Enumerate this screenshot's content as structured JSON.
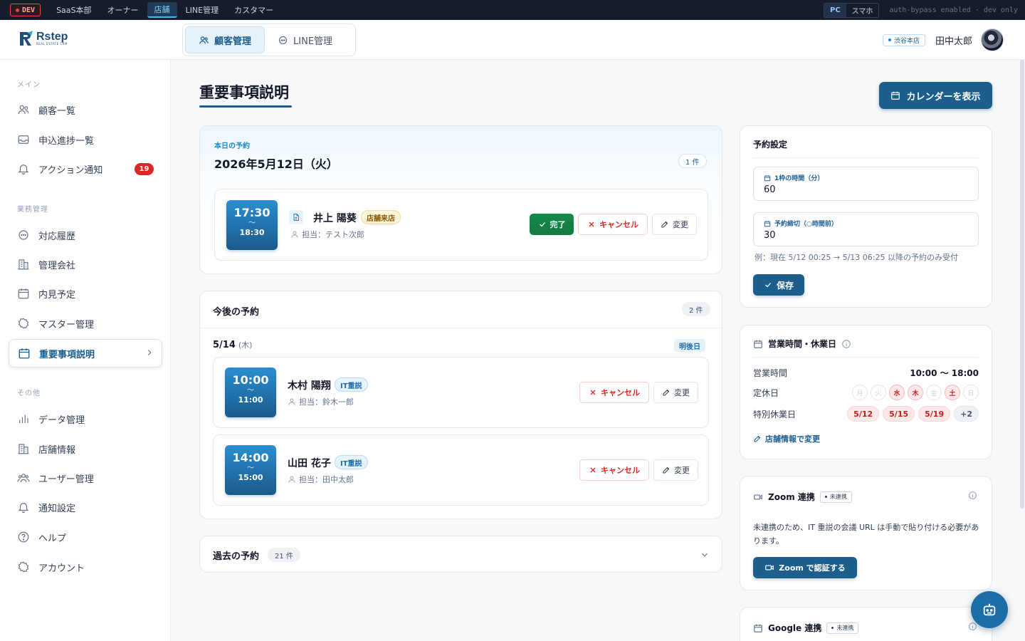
{
  "devbar": {
    "env_badge": "DEV",
    "nav": [
      "SaaS本部",
      "オーナー",
      "店舗",
      "LINE管理",
      "カスタマー"
    ],
    "active_nav": "店舗",
    "view_pc": "PC",
    "view_sp": "スマホ",
    "note": "auth-bypass enabled · dev only"
  },
  "header": {
    "logo_text": "Rstep",
    "logo_sub": "REAL ESTATE CRM",
    "tabs": [
      {
        "label": "顧客管理",
        "active": true
      },
      {
        "label": "LINE管理",
        "active": false
      }
    ],
    "store_badge": "渋谷本店",
    "user_name": "田中太郎"
  },
  "sidebar": {
    "sections": [
      {
        "label": "メイン",
        "items": [
          {
            "label": "顧客一覧",
            "icon": "users-icon"
          },
          {
            "label": "申込進捗一覧",
            "icon": "inbox-icon"
          },
          {
            "label": "アクション通知",
            "icon": "bell-icon",
            "count": "19"
          }
        ]
      },
      {
        "label": "業務管理",
        "items": [
          {
            "label": "対応履歴",
            "icon": "chat-icon"
          },
          {
            "label": "管理会社",
            "icon": "building-icon"
          },
          {
            "label": "内見予定",
            "icon": "calendar-icon"
          },
          {
            "label": "マスター管理",
            "icon": "gear-icon"
          },
          {
            "label": "重要事項説明",
            "icon": "calendar-icon",
            "active": true
          }
        ]
      },
      {
        "label": "その他",
        "items": [
          {
            "label": "データ管理",
            "icon": "bar-chart-icon"
          },
          {
            "label": "店舗情報",
            "icon": "building-icon"
          },
          {
            "label": "ユーザー管理",
            "icon": "users-icon"
          },
          {
            "label": "通知設定",
            "icon": "bell-icon"
          },
          {
            "label": "ヘルプ",
            "icon": "help-icon"
          },
          {
            "label": "アカウント",
            "icon": "gear-icon"
          }
        ]
      }
    ]
  },
  "main": {
    "title": "重要事項説明",
    "calendar_button": "カレンダーを表示",
    "today": {
      "label": "本日の予約",
      "date": "2026年5月12日（火）",
      "count": "1 件",
      "item": {
        "start": "17:30",
        "sep": "〜",
        "end": "18:30",
        "name": "井上 陽葵",
        "tag": "店舗来店",
        "staff": "担当：テスト次郎",
        "done_label": "完了",
        "cancel_label": "キャンセル",
        "edit_label": "変更"
      }
    },
    "upcoming": {
      "title": "今後の予約",
      "count": "2 件",
      "date": "5/14",
      "dow": "(木)",
      "date_badge": "明後日",
      "items": [
        {
          "start": "10:00",
          "sep": "〜",
          "end": "11:00",
          "name": "木村 陽翔",
          "tag": "IT重説",
          "staff": "担当：鈴木一郎",
          "cancel_label": "キャンセル",
          "edit_label": "変更"
        },
        {
          "start": "14:00",
          "sep": "〜",
          "end": "15:00",
          "name": "山田 花子",
          "tag": "IT重説",
          "staff": "担当：田中太郎",
          "cancel_label": "キャンセル",
          "edit_label": "変更"
        }
      ]
    },
    "past": {
      "title": "過去の予約",
      "count": "21 件"
    }
  },
  "settings": {
    "title": "予約設定",
    "slot_label": "1枠の時間（分）",
    "slot_value": "60",
    "deadline_label": "予約締切（○時間前）",
    "deadline_value": "30",
    "example": "例：現在 5/12 00:25 → 5/13 06:25 以降の予約のみ受付",
    "save_label": "保存"
  },
  "hours": {
    "title": "営業時間・休業日",
    "hours_label": "営業時間",
    "hours_value": "10:00 〜 18:00",
    "closed_label": "定休日",
    "weekdays": [
      {
        "d": "月",
        "off": false
      },
      {
        "d": "火",
        "off": false
      },
      {
        "d": "水",
        "off": true
      },
      {
        "d": "木",
        "off": true
      },
      {
        "d": "金",
        "off": false
      },
      {
        "d": "土",
        "off": true
      },
      {
        "d": "日",
        "off": false
      }
    ],
    "special_label": "特別休業日",
    "special_days": [
      "5/12",
      "5/15",
      "5/19",
      "+2"
    ],
    "edit_link": "店舗情報で変更"
  },
  "zoom": {
    "title": "Zoom 連携",
    "status": "未連携",
    "text": "未連携のため、IT 重説の会議 URL は手動で貼り付ける必要があります。",
    "button": "Zoom で認証する"
  },
  "google": {
    "title": "Google 連携",
    "status": "未連携"
  },
  "colors": {
    "primary": "#1c5f8c",
    "accent": "#1e88c8",
    "danger": "#dc2626",
    "success": "#15803d"
  }
}
